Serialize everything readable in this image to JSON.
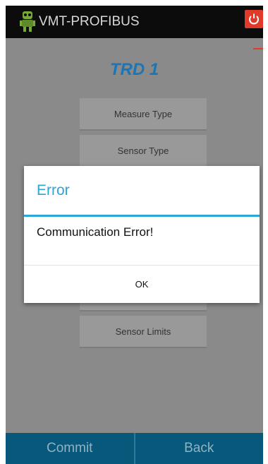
{
  "app": {
    "title": "VMT-PROFIBUS"
  },
  "screen": {
    "title": "TRD 1"
  },
  "menu": {
    "items": [
      {
        "label": "Measure Type"
      },
      {
        "label": "Sensor Type"
      },
      {
        "label": ""
      },
      {
        "label": ""
      },
      {
        "label": ""
      },
      {
        "label": "Sensor Limits"
      }
    ]
  },
  "bottom": {
    "commit_label": "Commit",
    "back_label": "Back"
  },
  "dialog": {
    "title": "Error",
    "message": "Communication Error!",
    "ok_label": "OK"
  },
  "colors": {
    "accent": "#2aa6d8",
    "title_blue": "#1a76b5",
    "power_red": "#e03a2a",
    "bottom_bar": "#07587a"
  },
  "icons": {
    "app": "robot-icon",
    "power": "power-icon"
  }
}
